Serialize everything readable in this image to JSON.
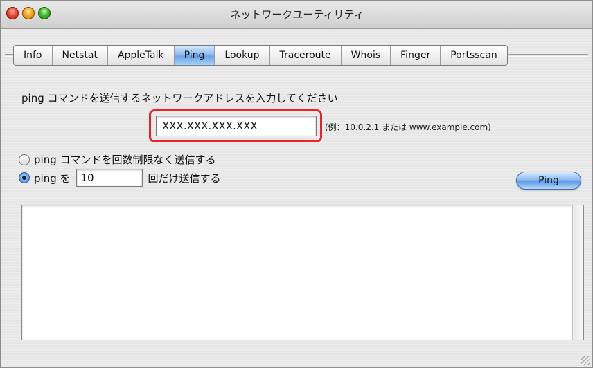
{
  "window": {
    "title": "ネットワークユーティリティ"
  },
  "tabs": [
    {
      "label": "Info",
      "active": false
    },
    {
      "label": "Netstat",
      "active": false
    },
    {
      "label": "AppleTalk",
      "active": false
    },
    {
      "label": "Ping",
      "active": true
    },
    {
      "label": "Lookup",
      "active": false
    },
    {
      "label": "Traceroute",
      "active": false
    },
    {
      "label": "Whois",
      "active": false
    },
    {
      "label": "Finger",
      "active": false
    },
    {
      "label": "Portsscan",
      "active": false
    }
  ],
  "ping": {
    "prompt": "ping コマンドを送信するネットワークアドレスを入力してください",
    "address_value": "XXX.XXX.XXX.XXX",
    "example": "(例：10.0.2.1 または www.example.com)",
    "radio_unlimited_label": "ping コマンドを回数制限なく送信する",
    "radio_count_prefix": "ping を",
    "count_value": "10",
    "radio_count_suffix": "回だけ送信する",
    "button_label": "Ping",
    "output_text": ""
  },
  "colors": {
    "highlight": "#e8232a",
    "active_tab": "#6aa3e8"
  }
}
